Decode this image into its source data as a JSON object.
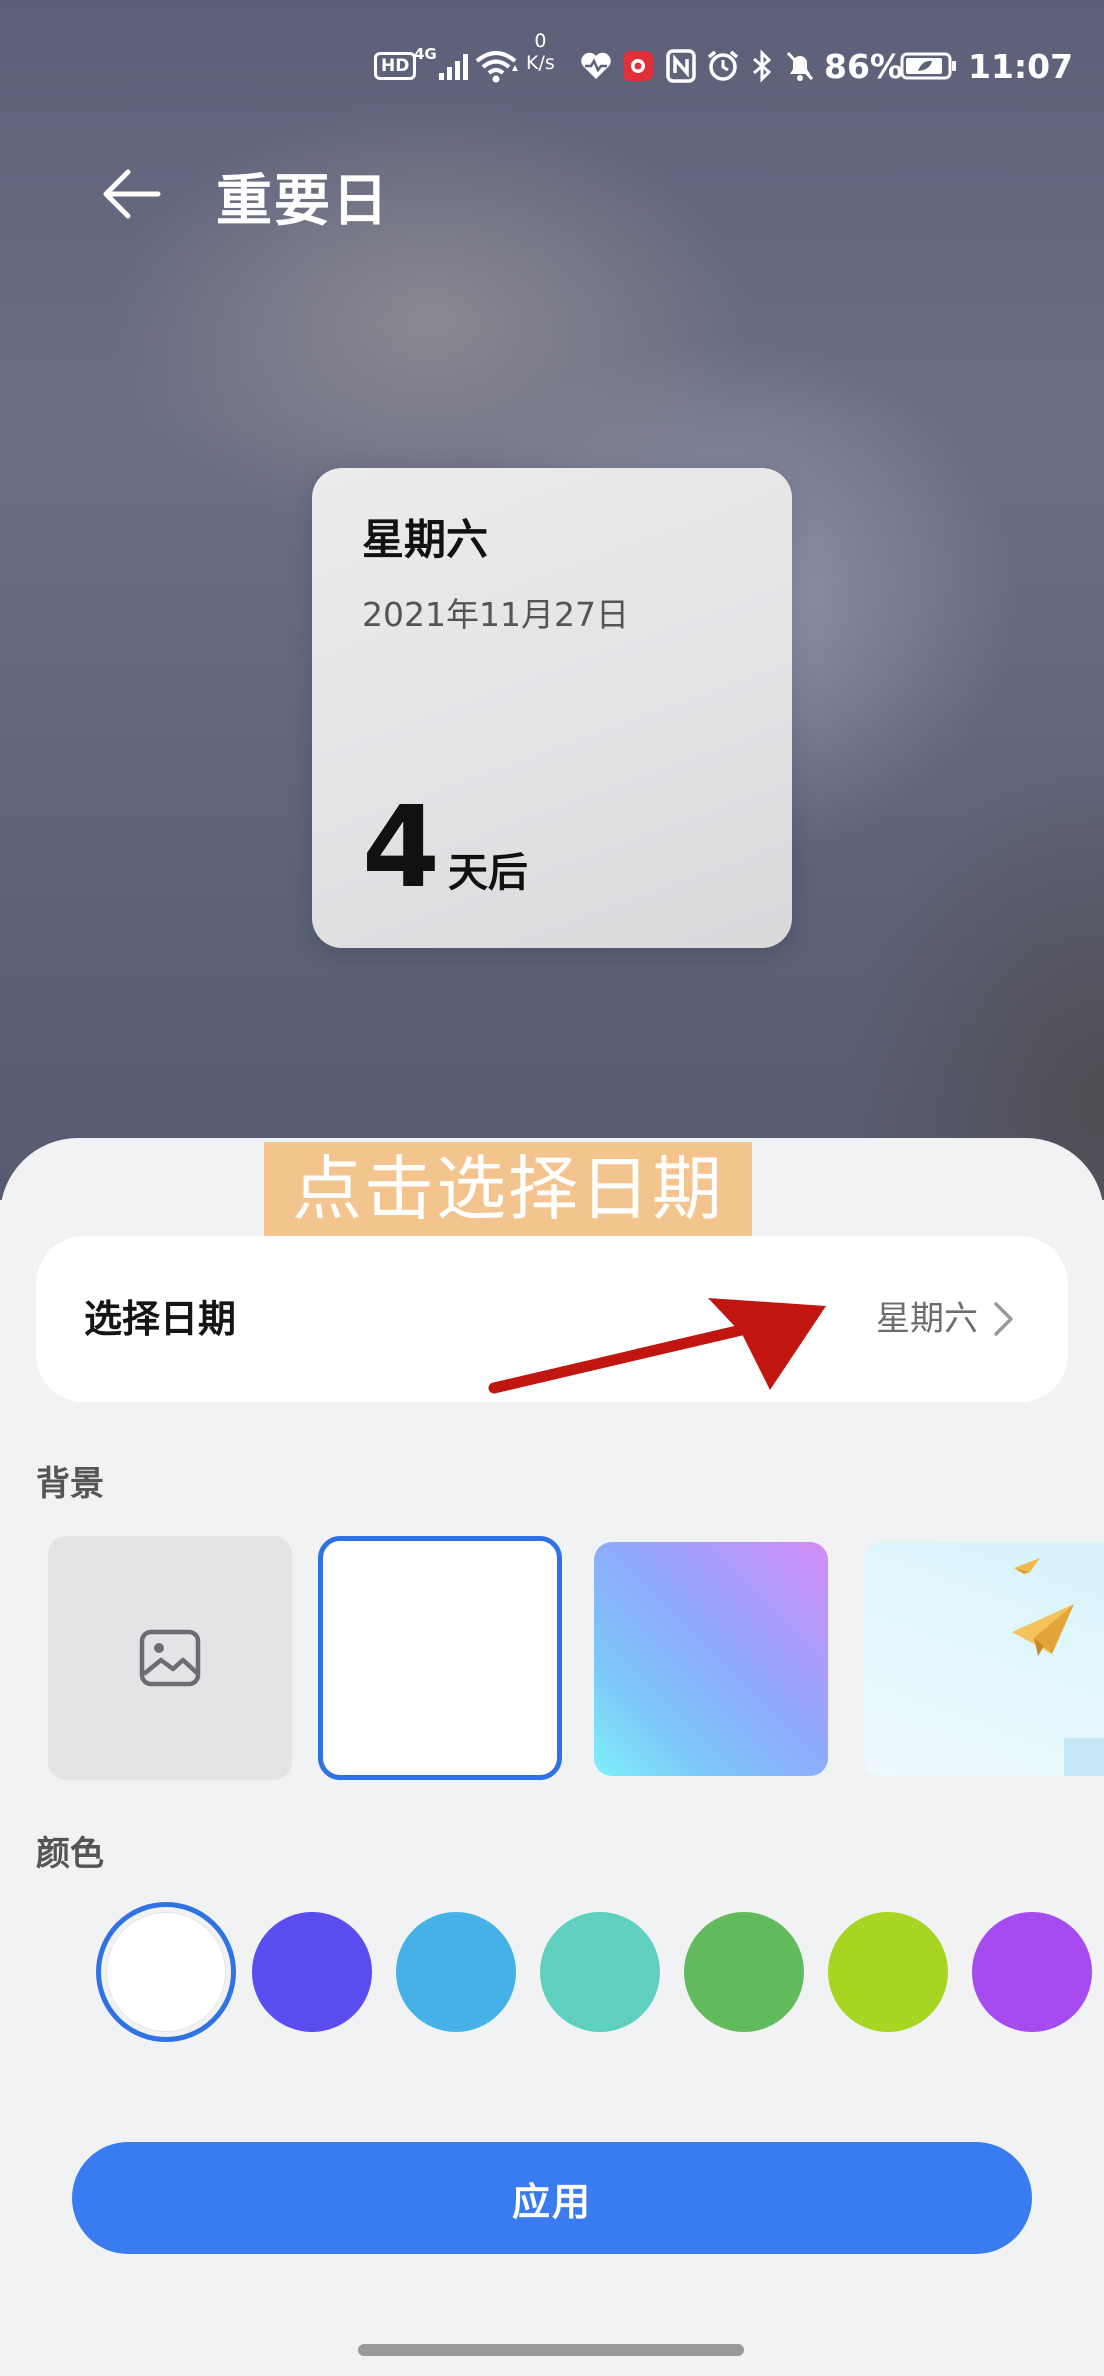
{
  "status_bar": {
    "hd": "HD",
    "network": "4G",
    "net_speed_value": "0",
    "net_speed_unit": "K/s",
    "battery_percent": "86%",
    "time": "11:07"
  },
  "header": {
    "title": "重要日"
  },
  "preview": {
    "weekday": "星期六",
    "date": "2021年11月27日",
    "count": "4",
    "count_unit": "天后"
  },
  "hint": {
    "text": "点击选择日期"
  },
  "date_picker": {
    "label": "选择日期",
    "value": "星期六"
  },
  "background_section": {
    "label": "背景",
    "options": [
      "image-picker",
      "white",
      "gradient",
      "sky-paper-planes"
    ],
    "selected_index": 1
  },
  "color_section": {
    "label": "颜色",
    "swatches": [
      "#ffffff",
      "#5a4ef0",
      "#45b1e6",
      "#5fd0bf",
      "#62bb5c",
      "#a8d521",
      "#a64bf0"
    ],
    "selected_index": 0
  },
  "apply_button": {
    "label": "应用"
  },
  "colors": {
    "accent": "#3a7cf0",
    "selection_ring": "#2f72e6",
    "annotation_arrow": "#c0160f",
    "hint_banner": "#f3c48e"
  }
}
